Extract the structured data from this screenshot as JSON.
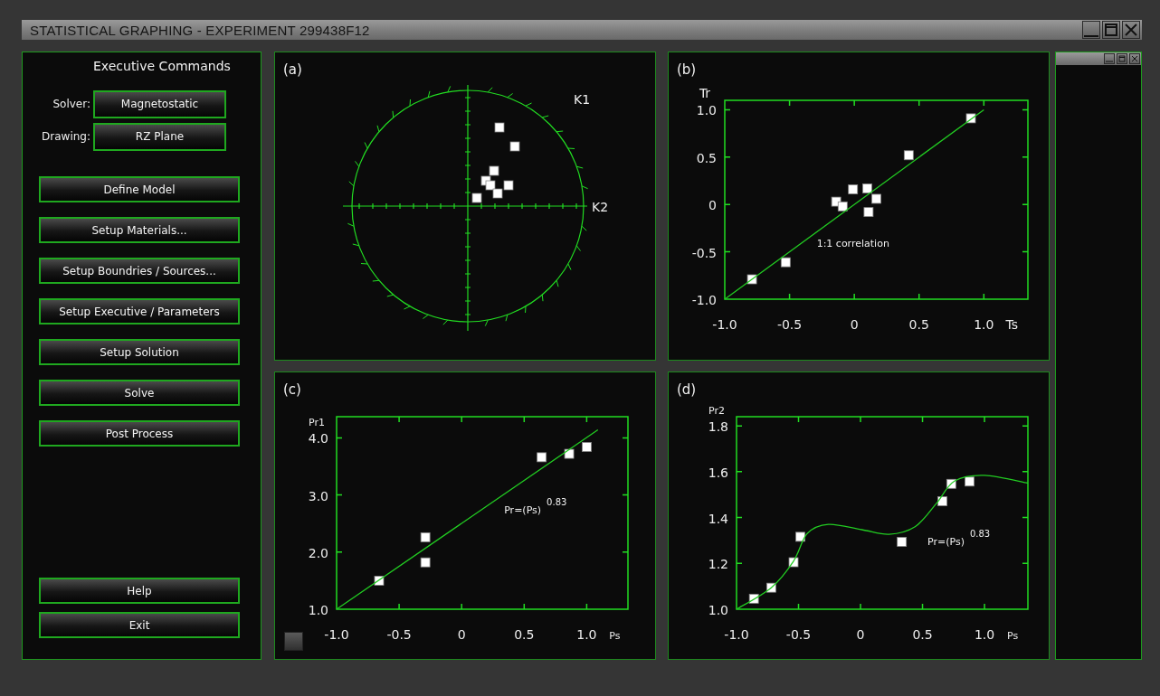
{
  "window": {
    "title": "STATISTICAL GRAPHING - EXPERIMENT 299438F12"
  },
  "command_panel": {
    "title": "Executive Commands",
    "fields": [
      {
        "label": "Solver:",
        "value": "Magnetostatic"
      },
      {
        "label": "Drawing:",
        "value": "RZ Plane"
      }
    ],
    "commands": [
      "Define Model",
      "Setup Materials...",
      "Setup Boundries / Sources...",
      "Setup Executive / Parameters",
      "Setup Solution",
      "Solve",
      "Post Process"
    ],
    "footer_buttons": [
      "Help",
      "Exit"
    ]
  },
  "charts": [
    {
      "label": "(a)",
      "kind": "polar",
      "axis_labels": [
        "K1",
        "K2"
      ]
    },
    {
      "label": "(b)",
      "kind": "cartesian",
      "chart_data": {
        "type": "scatter",
        "xlabel": "Ts",
        "ylabel": "Tr",
        "xlim": [
          -1,
          1.34
        ],
        "ylim": [
          -1,
          1.1
        ],
        "xticks": [
          {
            "value": -1,
            "label": "-1.0"
          },
          {
            "value": -0.5,
            "label": "-0.5"
          },
          {
            "value": 0,
            "label": "0"
          },
          {
            "value": 0.5,
            "label": "0.5"
          },
          {
            "value": 1,
            "label": "1.0"
          }
        ],
        "yticks": [
          {
            "value": -1,
            "label": "-1.0"
          },
          {
            "value": -0.5,
            "label": "-0.5"
          },
          {
            "value": 0,
            "label": "0"
          },
          {
            "value": 0.5,
            "label": "0.5"
          },
          {
            "value": 1,
            "label": "1.0"
          }
        ],
        "series": [
          {
            "type": "scatter",
            "color": "#ffffff",
            "x": [
              -0.79,
              -0.53,
              -0.14,
              -0.09,
              -0.01,
              0.1,
              0.17,
              0.11,
              0.42,
              0.9
            ],
            "values": [
              -0.79,
              -0.61,
              0.03,
              -0.02,
              0.16,
              0.17,
              0.06,
              -0.08,
              0.52,
              0.91
            ]
          },
          {
            "type": "line",
            "color": "#22cc22",
            "x": [
              -1,
              1
            ],
            "values": [
              -1,
              1
            ]
          }
        ],
        "annotations": [
          "1:1 correlation"
        ]
      }
    },
    {
      "label": "(c)",
      "kind": "cartesian",
      "chart_data": {
        "type": "scatter",
        "xlabel": "Ps",
        "ylabel": "Pr1",
        "xlim": [
          -1,
          1.33
        ],
        "ylim": [
          1,
          4.37
        ],
        "xticks": [
          {
            "value": -1,
            "label": "-1.0"
          },
          {
            "value": -0.5,
            "label": "-0.5"
          },
          {
            "value": 0,
            "label": "0"
          },
          {
            "value": 0.5,
            "label": "0.5"
          },
          {
            "value": 1,
            "label": "1.0"
          }
        ],
        "yticks": [
          {
            "value": 1,
            "label": "1.0"
          },
          {
            "value": 2,
            "label": "2.0"
          },
          {
            "value": 3,
            "label": "3.0"
          },
          {
            "value": 4,
            "label": "4.0"
          }
        ],
        "series": [
          {
            "type": "scatter",
            "color": "#ffffff",
            "x": [
              -0.66,
              -0.29,
              -0.29,
              0.64,
              0.86,
              1.0
            ],
            "values": [
              1.5,
              2.26,
              1.82,
              3.66,
              3.72,
              3.84
            ]
          },
          {
            "type": "line",
            "color": "#22cc22",
            "x": [
              -1,
              1.09
            ],
            "values": [
              1,
              4.14
            ]
          }
        ],
        "annotations": [
          "Pr=(Ps)$^{0.83}$"
        ]
      }
    },
    {
      "label": "(d)",
      "kind": "cartesian",
      "chart_data": {
        "type": "scatter",
        "xlabel": "Ps",
        "ylabel": "Pr2",
        "xlim": [
          -1,
          1.35
        ],
        "ylim": [
          1,
          1.84
        ],
        "xticks": [
          {
            "value": -1,
            "label": "-1.0"
          },
          {
            "value": -0.5,
            "label": "-0.5"
          },
          {
            "value": 0,
            "label": "0"
          },
          {
            "value": 0.5,
            "label": "0.5"
          },
          {
            "value": 1,
            "label": "1.0"
          }
        ],
        "yticks": [
          {
            "value": 1,
            "label": "1.0"
          },
          {
            "value": 1.2,
            "label": "1.2"
          },
          {
            "value": 1.4,
            "label": "1.4"
          },
          {
            "value": 1.6,
            "label": "1.6"
          },
          {
            "value": 1.8,
            "label": "1.8"
          }
        ],
        "series": [
          {
            "type": "scatter",
            "color": "#ffffff",
            "x": [
              -0.86,
              -0.72,
              -0.54,
              -0.485,
              0.333,
              0.661,
              0.732,
              0.879
            ],
            "values": [
              1.046,
              1.094,
              1.205,
              1.316,
              1.294,
              1.471,
              1.547,
              1.557
            ]
          },
          {
            "type": "line",
            "color": "#22cc22",
            "x": [
              -1,
              -0.72,
              -0.54,
              -0.43,
              -0.26,
              0.01,
              0.23,
              0.44,
              0.61,
              0.76,
              1.0,
              1.35
            ],
            "values": [
              1.0,
              1.094,
              1.21,
              1.33,
              1.37,
              1.347,
              1.327,
              1.36,
              1.46,
              1.56,
              1.584,
              1.55
            ]
          }
        ],
        "annotations": [
          "Pr=(Ps)$^{0.83}$"
        ]
      }
    }
  ]
}
